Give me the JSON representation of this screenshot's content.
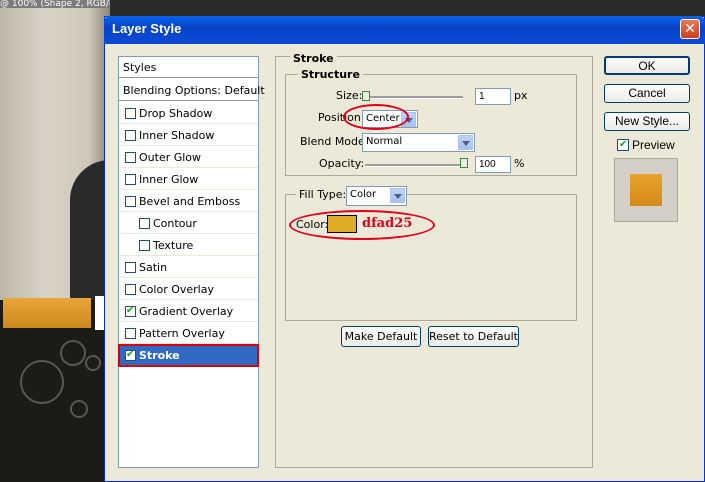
{
  "background": {
    "window_title_fragment": "@ 100% (Shape 2, RGB/8)"
  },
  "dialog": {
    "title": "Layer Style",
    "close_glyph": "✕"
  },
  "styles_list": {
    "header": "Styles",
    "blending": "Blending Options: Default",
    "items": [
      {
        "label": "Drop Shadow",
        "checked": false
      },
      {
        "label": "Inner Shadow",
        "checked": false
      },
      {
        "label": "Outer Glow",
        "checked": false
      },
      {
        "label": "Inner Glow",
        "checked": false
      },
      {
        "label": "Bevel and Emboss",
        "checked": false
      },
      {
        "label": "Contour",
        "checked": false
      },
      {
        "label": "Texture",
        "checked": false
      },
      {
        "label": "Satin",
        "checked": false
      },
      {
        "label": "Color Overlay",
        "checked": false
      },
      {
        "label": "Gradient Overlay",
        "checked": true
      },
      {
        "label": "Pattern Overlay",
        "checked": false
      },
      {
        "label": "Stroke",
        "checked": true
      }
    ],
    "selected": "Stroke",
    "check_glyph": "✔"
  },
  "stroke": {
    "title": "Stroke",
    "structure_title": "Structure",
    "size_label": "Size:",
    "size_value": "1",
    "size_unit": "px",
    "position_label": "Position:",
    "position_value": "Center",
    "blend_mode_label": "Blend Mode:",
    "blend_mode_value": "Normal",
    "opacity_label": "Opacity:",
    "opacity_value": "100",
    "opacity_unit": "%",
    "fill_type_label": "Fill Type:",
    "fill_type_value": "Color",
    "color_label": "Color:",
    "color_swatch": "#dfad25",
    "color_annotation": "dfad25",
    "make_default": "Make Default",
    "reset_default": "Reset to Default"
  },
  "buttons": {
    "ok": "OK",
    "cancel": "Cancel",
    "new_style": "New Style...",
    "preview": "Preview",
    "preview_checked": true
  },
  "colors": {
    "accent": "#316ac5",
    "annotation_red": "#e0001a",
    "swatch": "#dfad25",
    "preview_fill": "#e39a24"
  }
}
